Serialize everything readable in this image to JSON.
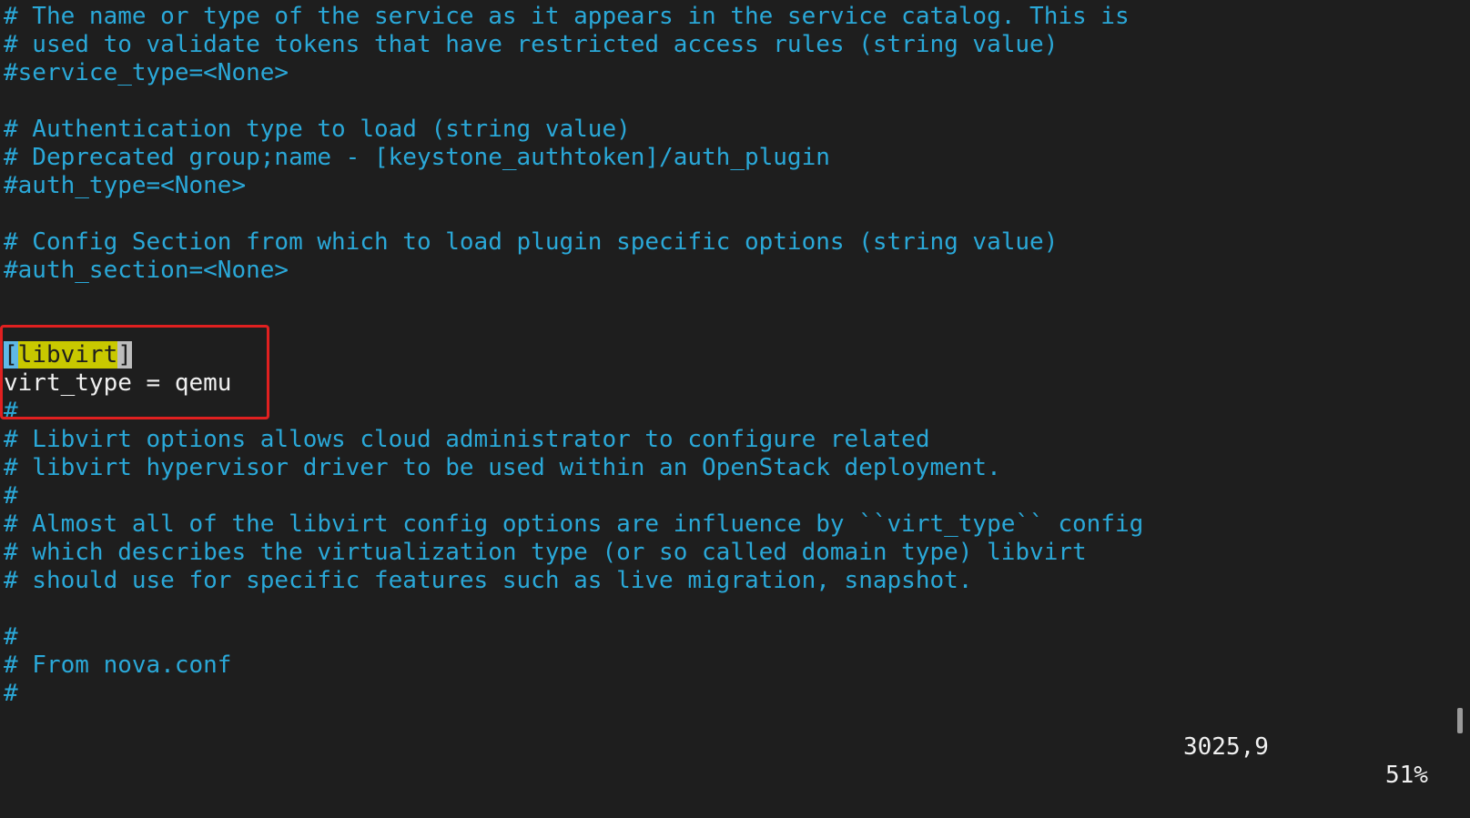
{
  "editor": {
    "lines": [
      {
        "kind": "comment",
        "text": "# The name or type of the service as it appears in the service catalog. This is"
      },
      {
        "kind": "comment",
        "text": "# used to validate tokens that have restricted access rules (string value)"
      },
      {
        "kind": "comment",
        "text": "#service_type=<None>"
      },
      {
        "kind": "comment",
        "text": ""
      },
      {
        "kind": "comment",
        "text": "# Authentication type to load (string value)"
      },
      {
        "kind": "comment",
        "text": "# Deprecated group;name - [keystone_authtoken]/auth_plugin"
      },
      {
        "kind": "comment",
        "text": "#auth_type=<None>"
      },
      {
        "kind": "comment",
        "text": ""
      },
      {
        "kind": "comment",
        "text": "# Config Section from which to load plugin specific options (string value)"
      },
      {
        "kind": "comment",
        "text": "#auth_section=<None>"
      },
      {
        "kind": "comment",
        "text": ""
      },
      {
        "kind": "comment",
        "text": ""
      },
      {
        "kind": "section",
        "text": ""
      },
      {
        "kind": "code",
        "text": "virt_type = qemu"
      },
      {
        "kind": "comment",
        "text": "#"
      },
      {
        "kind": "comment",
        "text": "# Libvirt options allows cloud administrator to configure related"
      },
      {
        "kind": "comment",
        "text": "# libvirt hypervisor driver to be used within an OpenStack deployment."
      },
      {
        "kind": "comment",
        "text": "#"
      },
      {
        "kind": "comment",
        "text": "# Almost all of the libvirt config options are influence by ``virt_type`` config"
      },
      {
        "kind": "comment",
        "text": "# which describes the virtualization type (or so called domain type) libvirt"
      },
      {
        "kind": "comment",
        "text": "# should use for specific features such as live migration, snapshot."
      },
      {
        "kind": "comment",
        "text": ""
      },
      {
        "kind": "comment",
        "text": "#"
      },
      {
        "kind": "comment",
        "text": "# From nova.conf"
      },
      {
        "kind": "comment",
        "text": "#"
      }
    ],
    "section": {
      "open_bracket": "[",
      "name": "libvirt",
      "close_bracket": "]"
    }
  },
  "status": {
    "cursor_position": "3025,9",
    "scroll_percent": "51%"
  },
  "colors": {
    "background": "#1e1e1e",
    "comment": "#2aa8d8",
    "code": "#f0f0f0",
    "highlight_box": "#e02020",
    "search_match": "#c8c800"
  }
}
